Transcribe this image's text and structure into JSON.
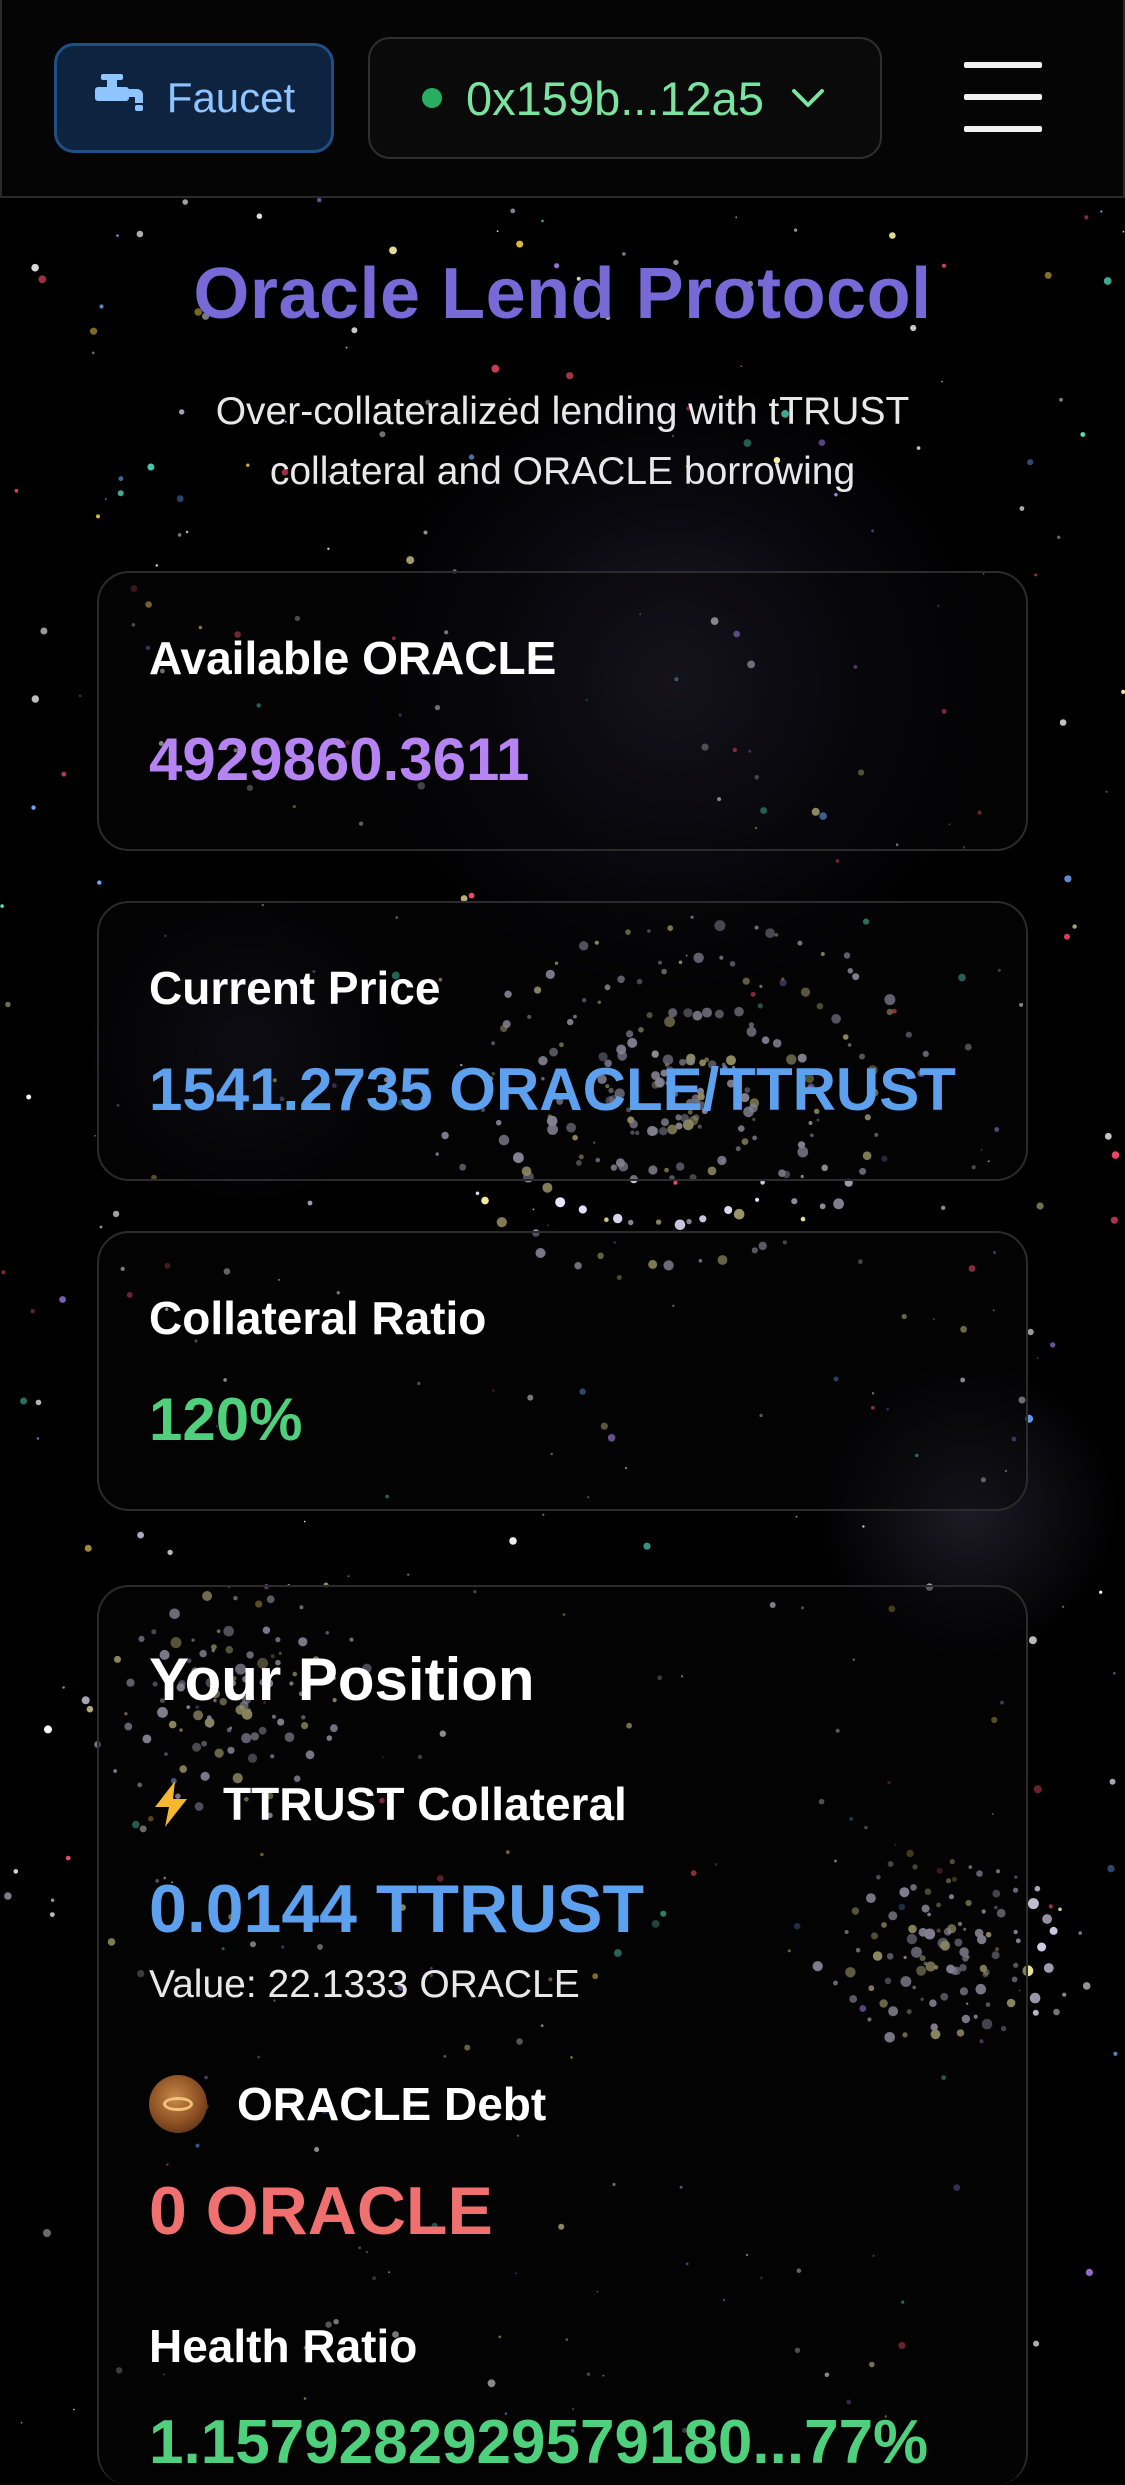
{
  "header": {
    "faucet_label": "Faucet",
    "wallet_address": "0x159b...12a5",
    "colors": {
      "faucet_text": "#8ec4ff",
      "wallet_text": "#7be3a1",
      "status_dot": "#27ae60"
    }
  },
  "main": {
    "title": "Oracle Lend Protocol",
    "subtitle_line1": "Over-collateralized lending with tTRUST",
    "subtitle_line2": "collateral and ORACLE borrowing",
    "stats": {
      "available": {
        "label": "Available ORACLE",
        "value": "4929860.3611"
      },
      "price": {
        "label": "Current Price",
        "value": "1541.2735 ORACLE/TTRUST"
      },
      "collateral_ratio": {
        "label": "Collateral Ratio",
        "value": "120%"
      }
    },
    "position": {
      "title": "Your Position",
      "collateral_label": "TTRUST Collateral",
      "collateral_value": "0.0144 TTRUST",
      "collateral_worth": "Value: 22.1333 ORACLE",
      "debt_label": "ORACLE Debt",
      "debt_value": "0 ORACLE",
      "health_label": "Health Ratio",
      "health_value": "1.1579282929579180...77%"
    }
  },
  "icons": [
    "faucet-icon",
    "wallet-status-dot",
    "chevron-down-icon",
    "hamburger-menu-icon",
    "lightning-bolt-icon",
    "oracle-token-icon"
  ],
  "colors": {
    "title": "#7769d6",
    "available_value": "#b684f2",
    "price_value": "#5da0ee",
    "ratio_value": "#4fd07c",
    "collateral_value": "#5da0ee",
    "debt_value": "#f07070"
  }
}
